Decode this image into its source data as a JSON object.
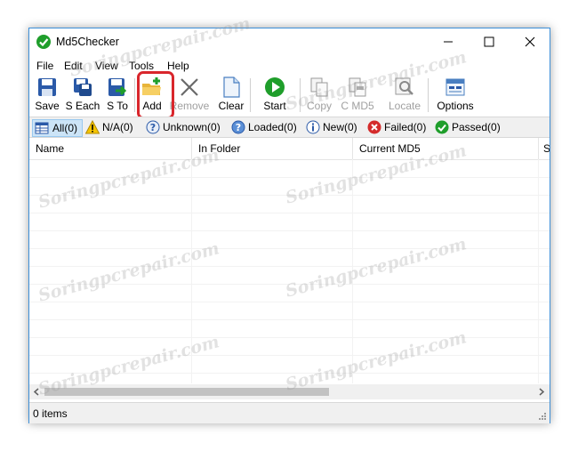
{
  "window": {
    "title": "Md5Checker"
  },
  "menu": [
    "File",
    "Edit",
    "View",
    "Tools",
    "Help"
  ],
  "toolbar": {
    "save": "Save",
    "s_each": "S Each",
    "s_to": "S To",
    "add": "Add",
    "remove": "Remove",
    "clear": "Clear",
    "start": "Start",
    "copy": "Copy",
    "c_md5": "C MD5",
    "locate": "Locate",
    "options": "Options"
  },
  "filters": {
    "all": "All(0)",
    "na": "N/A(0)",
    "unknown": "Unknown(0)",
    "loaded": "Loaded(0)",
    "new": "New(0)",
    "failed": "Failed(0)",
    "passed": "Passed(0)"
  },
  "columns": [
    "Name",
    "In Folder",
    "Current MD5",
    "S"
  ],
  "status": {
    "items": "0 items"
  },
  "watermark": "Soringpcrepair.com",
  "colors": {
    "accent": "#3c8fd8",
    "highlight": "#d9262c",
    "ok": "#1f9e2b",
    "error": "#d42b2b"
  }
}
